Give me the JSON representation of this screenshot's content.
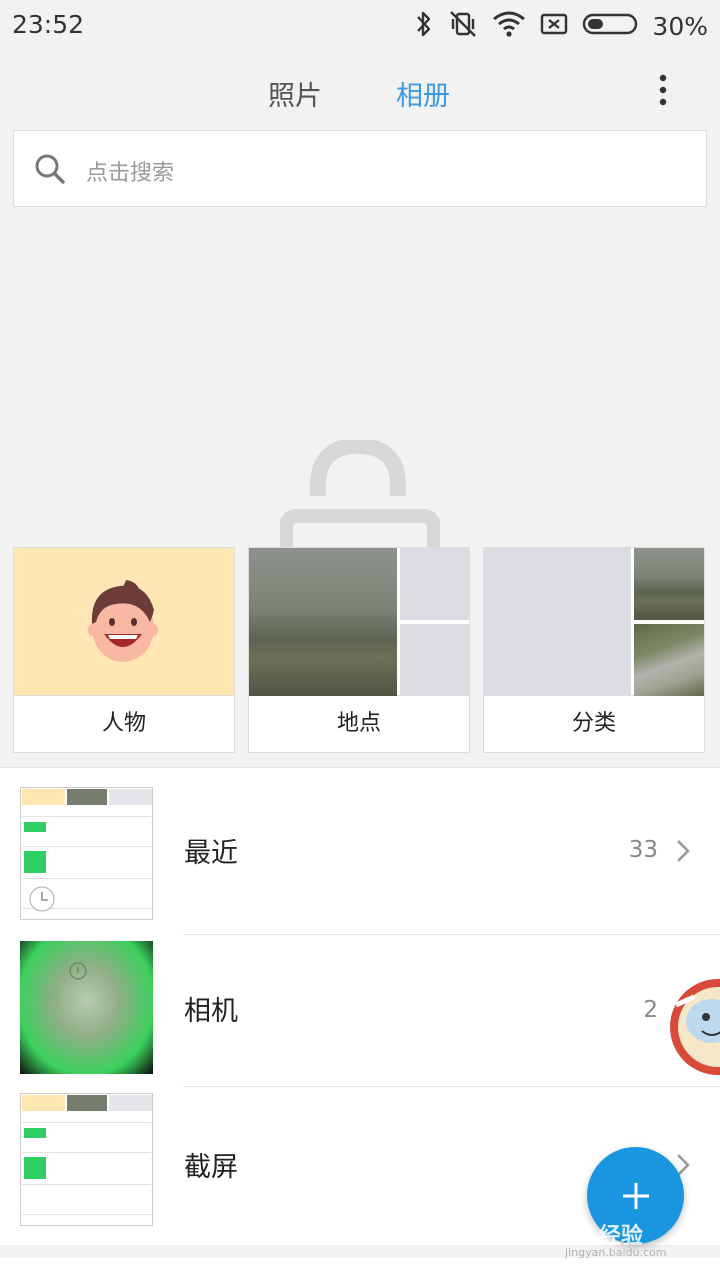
{
  "status_bar": {
    "time": "23:52",
    "battery_text": "30%",
    "icons": [
      "bluetooth-icon",
      "vibrate-off-icon",
      "wifi-icon",
      "no-sim-icon",
      "battery-icon"
    ]
  },
  "header": {
    "tabs": [
      {
        "label": "照片",
        "active": false
      },
      {
        "label": "相册",
        "active": true
      }
    ],
    "more_icon": "more-vertical-icon"
  },
  "search": {
    "placeholder": "点击搜索",
    "icon": "search-icon"
  },
  "categories": [
    {
      "label": "人物"
    },
    {
      "label": "地点"
    },
    {
      "label": "分类"
    }
  ],
  "albums": [
    {
      "name": "最近",
      "count": "33"
    },
    {
      "name": "相机",
      "count": "2"
    },
    {
      "name": "截屏",
      "count": ""
    }
  ],
  "fab": {
    "icon": "plus-icon"
  },
  "watermark": {
    "text": "Bai 经验",
    "sub": "jingyan.baidu.com"
  },
  "colors": {
    "accent": "#3b9ae1",
    "fab": "#1a95e0",
    "people_bg": "#ffe6b3"
  }
}
